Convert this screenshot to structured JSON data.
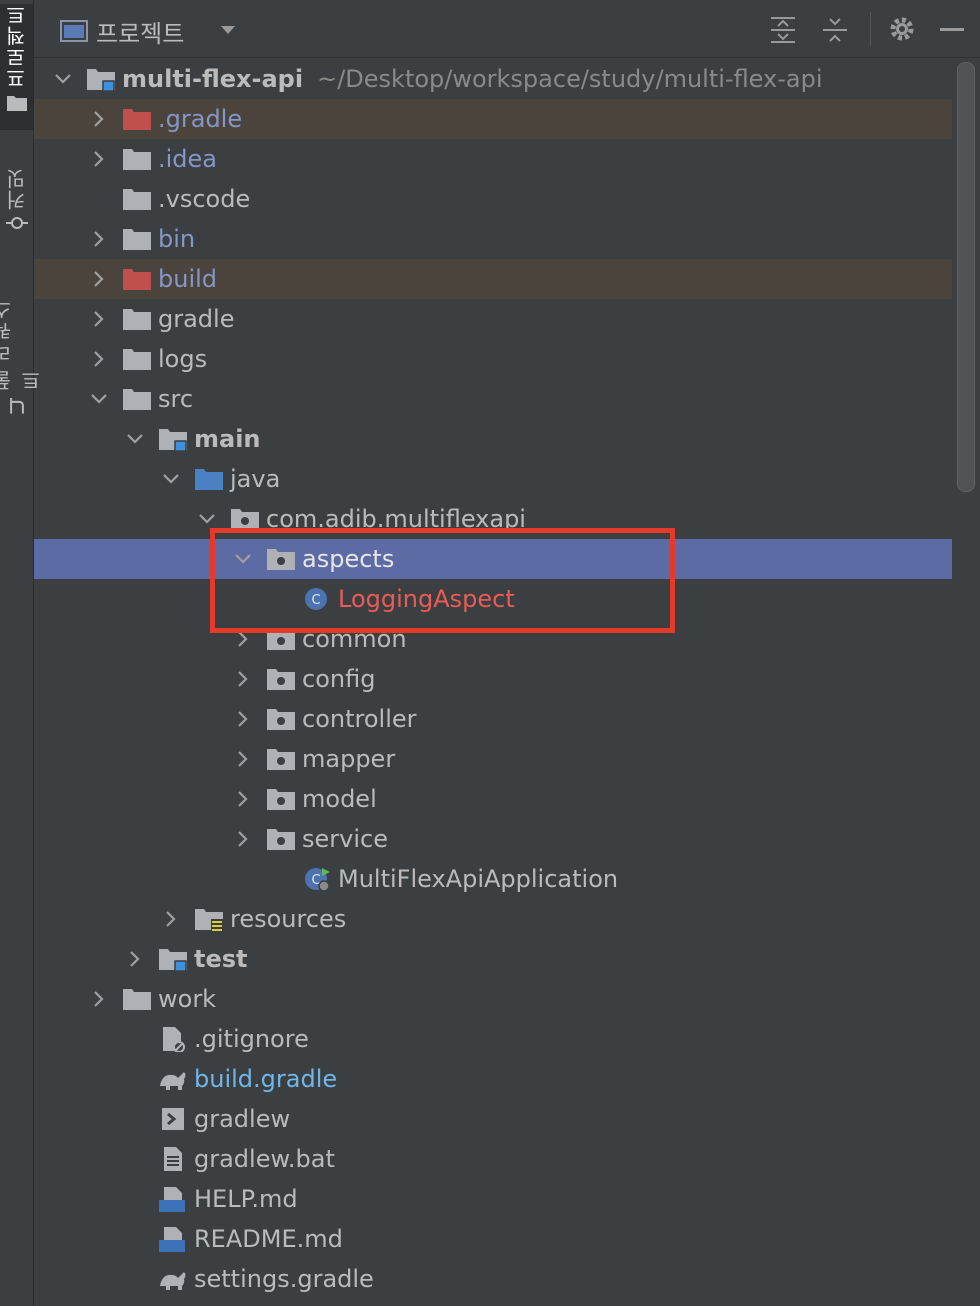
{
  "left_strip": {
    "tabs": [
      {
        "label": "프로젝트",
        "icon": "folder-icon",
        "active": true
      },
      {
        "label": "커밋",
        "icon": "commit-icon",
        "active": false
      },
      {
        "label": "풀 리퀘스트",
        "icon": "pull-request-icon",
        "active": false
      }
    ]
  },
  "header": {
    "title": "프로젝트",
    "dropdown_icon": "chevron-down-icon",
    "toolbar_icons": [
      "expand-all-icon",
      "collapse-all-icon",
      "gear-icon",
      "minimize-icon"
    ]
  },
  "tree": {
    "root": {
      "name": "multi-flex-api",
      "path": "~/Desktop/workspace/study/multi-flex-api"
    },
    "rows": [
      {
        "label": ".gradle",
        "style": "excluded"
      },
      {
        "label": ".idea",
        "style": "excluded"
      },
      {
        "label": ".vscode",
        "style": "normal"
      },
      {
        "label": "bin",
        "style": "excluded"
      },
      {
        "label": "build",
        "style": "excluded"
      },
      {
        "label": "gradle",
        "style": "normal"
      },
      {
        "label": "logs",
        "style": "normal"
      },
      {
        "label": "src",
        "style": "normal"
      },
      {
        "label": "main",
        "style": "bold"
      },
      {
        "label": "java",
        "style": "normal"
      },
      {
        "label": "com.adib.multiflexapi",
        "style": "normal"
      },
      {
        "label": "aspects",
        "style": "white"
      },
      {
        "label": "LoggingAspect",
        "style": "new"
      },
      {
        "label": "common",
        "style": "normal"
      },
      {
        "label": "config",
        "style": "normal"
      },
      {
        "label": "controller",
        "style": "normal"
      },
      {
        "label": "mapper",
        "style": "normal"
      },
      {
        "label": "model",
        "style": "normal"
      },
      {
        "label": "service",
        "style": "normal"
      },
      {
        "label": "MultiFlexApiApplication",
        "style": "normal"
      },
      {
        "label": "resources",
        "style": "normal"
      },
      {
        "label": "test",
        "style": "bold"
      },
      {
        "label": "work",
        "style": "normal"
      },
      {
        "label": ".gitignore",
        "style": "normal"
      },
      {
        "label": "build.gradle",
        "style": "modified"
      },
      {
        "label": "gradlew",
        "style": "normal"
      },
      {
        "label": "gradlew.bat",
        "style": "normal"
      },
      {
        "label": "HELP.md",
        "style": "normal"
      },
      {
        "label": "README.md",
        "style": "normal"
      },
      {
        "label": "settings.gradle",
        "style": "normal"
      }
    ],
    "class_badge": "C",
    "md_badge": "MD"
  },
  "colors": {
    "background": "#3c3f41",
    "selection": "#5c6ba4",
    "ignored_row": "#4a443c",
    "excluded_text": "#8696c7",
    "new_file_text": "#ea5b57",
    "modified_text": "#6fb7e8",
    "highlight_box": "#e5392a"
  }
}
